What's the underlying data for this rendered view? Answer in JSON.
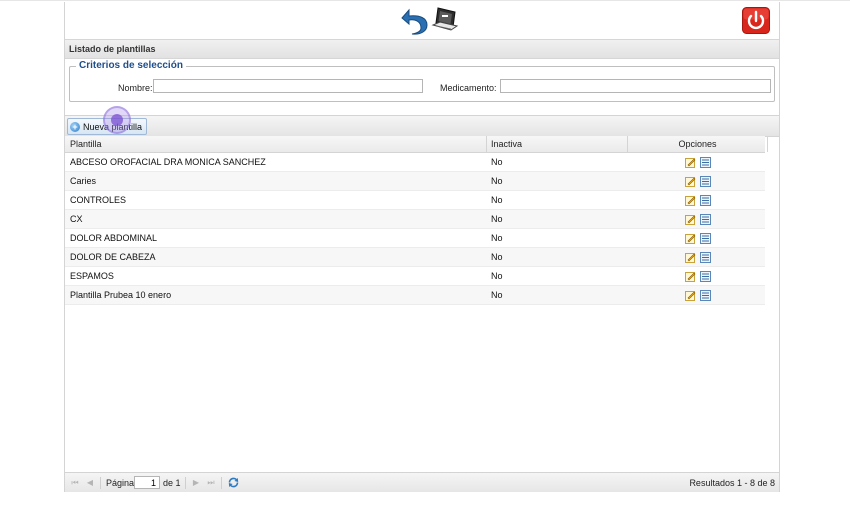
{
  "header": {
    "title": "Listado de plantillas",
    "icons": [
      "back-arrow-icon",
      "computer-icon",
      "power-icon"
    ],
    "power_color": "#d9261c"
  },
  "criteria": {
    "legend": "Criterios de selección",
    "nombre_label": "Nombre:",
    "nombre_value": "",
    "medicamento_label": "Medicamento:",
    "medicamento_value": ""
  },
  "toolbar": {
    "new_label": "Nueva plantilla"
  },
  "table": {
    "columns": [
      "Plantilla",
      "Inactiva",
      "Opciones"
    ],
    "rows": [
      {
        "plantilla": "ABCESO OROFACIAL DRA MONICA SANCHEZ",
        "inactiva": "No"
      },
      {
        "plantilla": "Caries",
        "inactiva": "No"
      },
      {
        "plantilla": "CONTROLES",
        "inactiva": "No"
      },
      {
        "plantilla": "CX",
        "inactiva": "No"
      },
      {
        "plantilla": "DOLOR ABDOMINAL",
        "inactiva": "No"
      },
      {
        "plantilla": "DOLOR DE CABEZA",
        "inactiva": "No"
      },
      {
        "plantilla": "ESPAMOS",
        "inactiva": "No"
      },
      {
        "plantilla": "Plantilla Prubea 10 enero",
        "inactiva": "No"
      }
    ]
  },
  "pager": {
    "page_label": "Página",
    "page_value": "1",
    "of_label": "de 1",
    "results": "Resultados 1 - 8 de 8"
  }
}
